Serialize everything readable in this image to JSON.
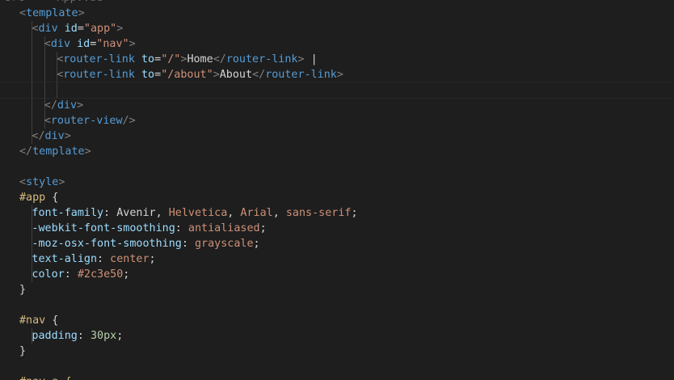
{
  "editor": {
    "language": "vue",
    "colors": {
      "background": "#1e1e1e",
      "tag": "#569cd6",
      "attribute": "#9cdcfe",
      "string": "#ce9178",
      "selector": "#d7ba7d",
      "number": "#b5cea8",
      "text": "#d4d4d4"
    },
    "lines": [
      {
        "indent": 0,
        "tokens": [
          {
            "t": "src > ▸ App.vue",
            "c": "dim"
          }
        ]
      },
      {
        "indent": 2,
        "tokens": [
          {
            "t": "<",
            "c": "br"
          },
          {
            "t": "template",
            "c": "tag"
          },
          {
            "t": ">",
            "c": "br"
          }
        ]
      },
      {
        "indent": 4,
        "tokens": [
          {
            "t": "<",
            "c": "br"
          },
          {
            "t": "div",
            "c": "tag"
          },
          {
            "t": " ",
            "c": "txt"
          },
          {
            "t": "id",
            "c": "attr"
          },
          {
            "t": "=",
            "c": "txt"
          },
          {
            "t": "\"app\"",
            "c": "str"
          },
          {
            "t": ">",
            "c": "br"
          }
        ]
      },
      {
        "indent": 6,
        "tokens": [
          {
            "t": "<",
            "c": "br"
          },
          {
            "t": "div",
            "c": "tag"
          },
          {
            "t": " ",
            "c": "txt"
          },
          {
            "t": "id",
            "c": "attr"
          },
          {
            "t": "=",
            "c": "txt"
          },
          {
            "t": "\"nav\"",
            "c": "str"
          },
          {
            "t": ">",
            "c": "br"
          }
        ]
      },
      {
        "indent": 8,
        "tokens": [
          {
            "t": "<",
            "c": "br"
          },
          {
            "t": "router-link",
            "c": "tag"
          },
          {
            "t": " ",
            "c": "txt"
          },
          {
            "t": "to",
            "c": "attr"
          },
          {
            "t": "=",
            "c": "txt"
          },
          {
            "t": "\"/\"",
            "c": "str"
          },
          {
            "t": ">",
            "c": "br"
          },
          {
            "t": "Home",
            "c": "txt"
          },
          {
            "t": "</",
            "c": "br"
          },
          {
            "t": "router-link",
            "c": "tag"
          },
          {
            "t": ">",
            "c": "br"
          },
          {
            "t": " |",
            "c": "txt"
          }
        ]
      },
      {
        "indent": 8,
        "tokens": [
          {
            "t": "<",
            "c": "br"
          },
          {
            "t": "router-link",
            "c": "tag"
          },
          {
            "t": " ",
            "c": "txt"
          },
          {
            "t": "to",
            "c": "attr"
          },
          {
            "t": "=",
            "c": "txt"
          },
          {
            "t": "\"/about\"",
            "c": "str"
          },
          {
            "t": ">",
            "c": "br"
          },
          {
            "t": "About",
            "c": "txt"
          },
          {
            "t": "</",
            "c": "br"
          },
          {
            "t": "router-link",
            "c": "tag"
          },
          {
            "t": ">",
            "c": "br"
          }
        ]
      },
      {
        "indent": 8,
        "current": true,
        "tokens": []
      },
      {
        "indent": 6,
        "tokens": [
          {
            "t": "</",
            "c": "br"
          },
          {
            "t": "div",
            "c": "tag"
          },
          {
            "t": ">",
            "c": "br"
          }
        ]
      },
      {
        "indent": 6,
        "tokens": [
          {
            "t": "<",
            "c": "br"
          },
          {
            "t": "router-view",
            "c": "tag"
          },
          {
            "t": "/>",
            "c": "br"
          }
        ]
      },
      {
        "indent": 4,
        "tokens": [
          {
            "t": "</",
            "c": "br"
          },
          {
            "t": "div",
            "c": "tag"
          },
          {
            "t": ">",
            "c": "br"
          }
        ]
      },
      {
        "indent": 2,
        "tokens": [
          {
            "t": "</",
            "c": "br"
          },
          {
            "t": "template",
            "c": "tag"
          },
          {
            "t": ">",
            "c": "br"
          }
        ]
      },
      {
        "indent": 0,
        "tokens": []
      },
      {
        "indent": 2,
        "tokens": [
          {
            "t": "<",
            "c": "br"
          },
          {
            "t": "style",
            "c": "tag"
          },
          {
            "t": ">",
            "c": "br"
          }
        ]
      },
      {
        "indent": 2,
        "tokens": [
          {
            "t": "#app",
            "c": "sel"
          },
          {
            "t": " {",
            "c": "punc"
          }
        ]
      },
      {
        "indent": 4,
        "tokens": [
          {
            "t": "font-family",
            "c": "prop"
          },
          {
            "t": ": ",
            "c": "punc"
          },
          {
            "t": "Avenir",
            "c": "txt"
          },
          {
            "t": ", ",
            "c": "punc"
          },
          {
            "t": "Helvetica",
            "c": "val"
          },
          {
            "t": ", ",
            "c": "punc"
          },
          {
            "t": "Arial",
            "c": "val"
          },
          {
            "t": ", ",
            "c": "punc"
          },
          {
            "t": "sans-serif",
            "c": "val"
          },
          {
            "t": ";",
            "c": "punc"
          }
        ]
      },
      {
        "indent": 4,
        "tokens": [
          {
            "t": "-webkit-font-smoothing",
            "c": "prop"
          },
          {
            "t": ": ",
            "c": "punc"
          },
          {
            "t": "antialiased",
            "c": "val"
          },
          {
            "t": ";",
            "c": "punc"
          }
        ]
      },
      {
        "indent": 4,
        "tokens": [
          {
            "t": "-moz-osx-font-smoothing",
            "c": "prop"
          },
          {
            "t": ": ",
            "c": "punc"
          },
          {
            "t": "grayscale",
            "c": "val"
          },
          {
            "t": ";",
            "c": "punc"
          }
        ]
      },
      {
        "indent": 4,
        "tokens": [
          {
            "t": "text-align",
            "c": "prop"
          },
          {
            "t": ": ",
            "c": "punc"
          },
          {
            "t": "center",
            "c": "val"
          },
          {
            "t": ";",
            "c": "punc"
          }
        ]
      },
      {
        "indent": 4,
        "tokens": [
          {
            "t": "color",
            "c": "prop"
          },
          {
            "t": ": ",
            "c": "punc"
          },
          {
            "t": "#2c3e50",
            "c": "val"
          },
          {
            "t": ";",
            "c": "punc"
          }
        ]
      },
      {
        "indent": 2,
        "tokens": [
          {
            "t": "}",
            "c": "punc"
          }
        ]
      },
      {
        "indent": 0,
        "tokens": []
      },
      {
        "indent": 2,
        "tokens": [
          {
            "t": "#nav",
            "c": "sel"
          },
          {
            "t": " {",
            "c": "punc"
          }
        ]
      },
      {
        "indent": 4,
        "tokens": [
          {
            "t": "padding",
            "c": "prop"
          },
          {
            "t": ": ",
            "c": "punc"
          },
          {
            "t": "30px",
            "c": "num"
          },
          {
            "t": ";",
            "c": "punc"
          }
        ]
      },
      {
        "indent": 2,
        "tokens": [
          {
            "t": "}",
            "c": "punc"
          }
        ]
      },
      {
        "indent": 0,
        "tokens": []
      },
      {
        "indent": 2,
        "tokens": [
          {
            "t": "#nav a {",
            "c": "sel"
          }
        ]
      }
    ]
  }
}
